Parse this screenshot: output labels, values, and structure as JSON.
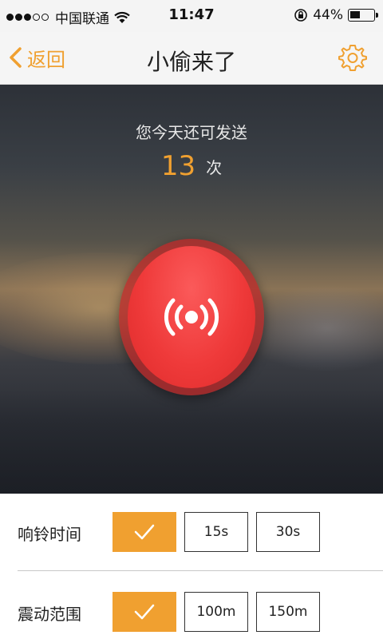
{
  "status_bar": {
    "carrier": "中国联通",
    "time": "11:47",
    "battery": "44%",
    "battery_level": 0.44
  },
  "nav": {
    "back_label": "返回",
    "title": "小偷来了"
  },
  "hero": {
    "remaining_label": "您今天还可发送",
    "remaining_count": "13",
    "remaining_unit": "次"
  },
  "options": {
    "ring_time": {
      "label": "响铃时间",
      "choices": [
        "15s",
        "30s"
      ]
    },
    "vibrate_range": {
      "label": "震动范围",
      "choices": [
        "100m",
        "150m"
      ]
    }
  },
  "colors": {
    "accent": "#f0a030",
    "alarm_red": "#ef3a3a"
  },
  "icons": {
    "back": "chevron-left-icon",
    "settings": "gear-icon",
    "alarm": "broadcast-icon",
    "check": "checkmark-icon"
  }
}
